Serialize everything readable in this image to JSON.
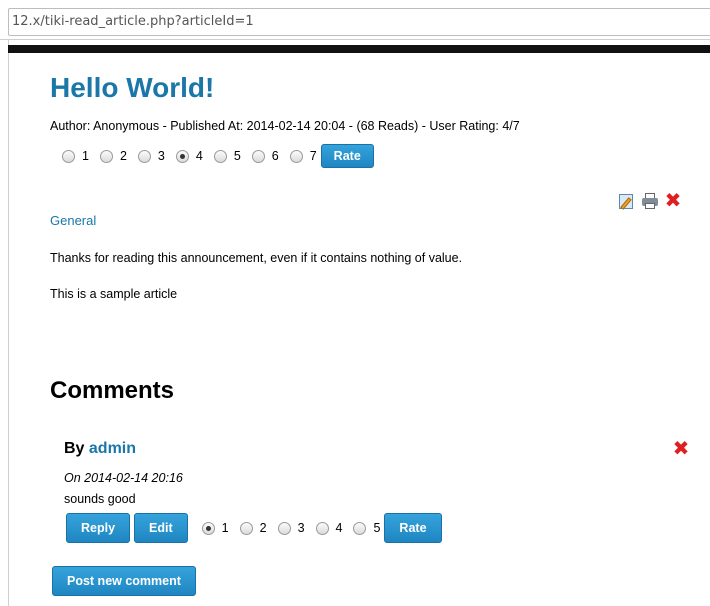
{
  "browser": {
    "url": "12.x/tiki-read_article.php?articleId=1"
  },
  "article": {
    "title": "Hello World!",
    "meta": "Author: Anonymous - Published At: 2014-02-14 20:04 - (68 Reads) - User Rating: 4/7",
    "rating": {
      "options": [
        "1",
        "2",
        "3",
        "4",
        "5",
        "6",
        "7"
      ],
      "selected": "4",
      "rate_label": "Rate"
    },
    "actions": {
      "edit_icon": "edit-icon",
      "print_icon": "print-icon",
      "delete_icon": "delete-icon"
    },
    "category": "General",
    "heading_text": "Thanks for reading this announcement, even if it contains nothing of value.",
    "body_text": "This is a sample article"
  },
  "comments": {
    "heading": "Comments",
    "items": [
      {
        "by_prefix": "By",
        "author": "admin",
        "date": "On 2014-02-14 20:16",
        "text": "sounds good",
        "reply_label": "Reply",
        "edit_label": "Edit",
        "rating_options": [
          "1",
          "2",
          "3",
          "4",
          "5"
        ],
        "rating_selected": "1",
        "rate_label": "Rate"
      }
    ],
    "post_label": "Post new comment"
  },
  "colors": {
    "link": "#1a77a8",
    "button": "#2a94cf",
    "delete": "#e02020"
  }
}
